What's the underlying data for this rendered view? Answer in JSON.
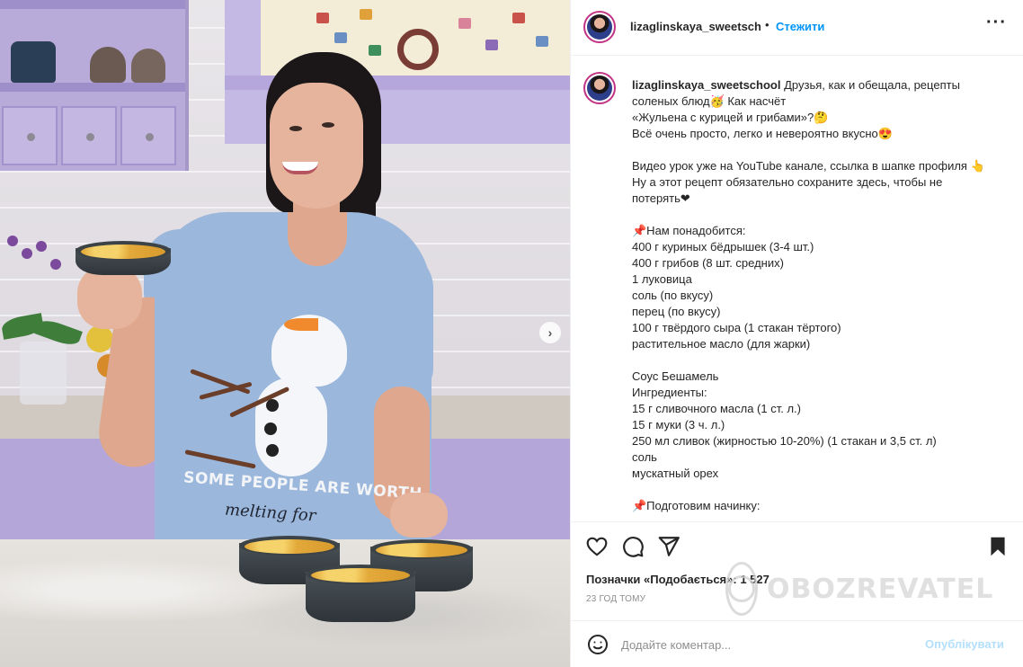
{
  "header": {
    "username": "lizaglinskaya_sweetschool",
    "follow_label": "Стежити",
    "more_icon": "more-horizontal-icon"
  },
  "caption": {
    "username": "lizaglinskaya_sweetschool",
    "lines": [
      "Друзья, как и обещала, рецепты",
      "соленых блюд🥳 Как насчёт",
      "«Жульена с курицей и грибами»?🤔",
      "Всё очень просто, легко и невероятно вкусно😍",
      "",
      "Видео урок уже на YouTube канале, ссылка в шапке профиля 👆",
      "Ну а этот рецепт обязательно сохраните здесь, чтобы не",
      "потерять❤",
      "",
      "📌Нам понадобится:",
      "400 г куриных бёдрышек (3-4 шт.)",
      "400 г грибов (8 шт. средних)",
      "1 луковица",
      "соль (по вкусу)",
      "перец (по вкусу)",
      "100 г твёрдого сыра (1 стакан тёртого)",
      "растительное масло (для жарки)",
      "",
      "Соус Бешамель",
      "Ингредиенты:",
      "15 г сливочного масла (1 ст. л.)",
      "15 г муки (3 ч. л.)",
      "250 мл сливок (жирностью 10-20%) (1 стакан и 3,5 ст. л)",
      "соль",
      "мускатный орех",
      "",
      "📌Подготовим начинку:"
    ]
  },
  "photo": {
    "shirt_text": "SOME PEOPLE ARE WORTH",
    "shirt_script": "melting for",
    "next_icon": "chevron-right-icon"
  },
  "actions": {
    "like_icon": "heart-icon",
    "comment_icon": "comment-icon",
    "share_icon": "send-icon",
    "save_icon": "bookmark-icon",
    "likes_prefix": "Позначки «Подобається»: ",
    "likes_count": "1 527",
    "time": "23 год тому"
  },
  "watermark": {
    "text": "OBOZREVATEL"
  },
  "comment": {
    "placeholder": "Додайте коментар...",
    "publish_label": "Опублікувати",
    "emoji_icon": "emoji-icon"
  },
  "colors": {
    "link_blue": "#0095f6",
    "publish_disabled": "#b2dffc",
    "muted_gray": "#8e8e8e"
  }
}
